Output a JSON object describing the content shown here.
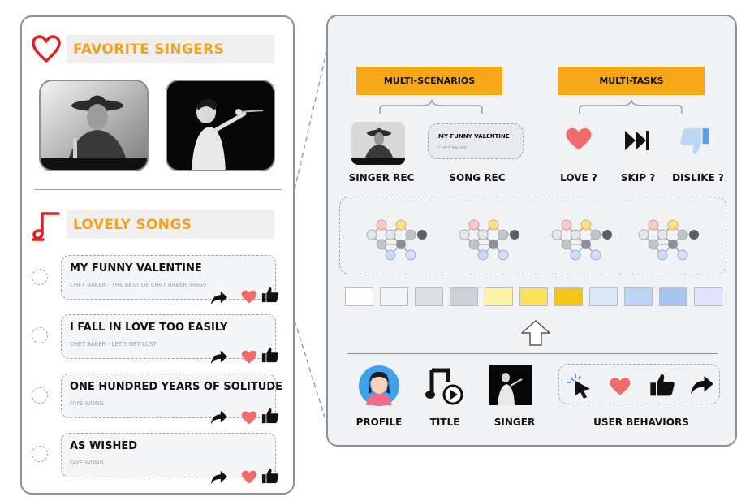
{
  "favorites": {
    "heading": "FAVORITE SINGERS"
  },
  "songs": {
    "heading": "LOVELY SONGS",
    "items": [
      {
        "title": "MY FUNNY VALENTINE",
        "subtitle": "CHET BAKER -  THE BEST OF CHET BAKER SINGS"
      },
      {
        "title": "I FALL IN LOVE TOO EASILY",
        "subtitle": "CHET BAKER -  LET'S GET LOST"
      },
      {
        "title": "ONE HUNDRED YEARS OF SOLITUDE",
        "subtitle": "FAYE WONG"
      },
      {
        "title": "AS WISHED",
        "subtitle": "FAYE WONG"
      }
    ]
  },
  "diagram": {
    "scenarios_label": "MULTI-SCENARIOS",
    "tasks_label": "MULTI-TASKS",
    "singer_rec": "SINGER REC",
    "song_rec": "SONG REC",
    "song_card_title": "MY FUNNY VALENTINE",
    "song_card_sub": "CHET BAKER",
    "love_q": "LOVE ?",
    "skip_q": "SKIP ?",
    "dislike_q": "DISLIKE ?",
    "profile": "PROFILE",
    "title": "TITLE",
    "singer": "SINGER",
    "user_behaviors": "USER BEHAVIORS"
  },
  "colors": {
    "accent_orange": "#f6a818",
    "heading_text": "#f4a21a",
    "heart": "#f26b6b",
    "red_icon": "#e02020",
    "dislike_blue": "#5b9ee8",
    "embedding": [
      "#ffffff",
      "#f3f4f6",
      "#dcdfe4",
      "#ccd0d7",
      "#fff3a8",
      "#fde15a",
      "#f6c51a",
      "#d9e8fb",
      "#bcd4f4",
      "#a6c4ee",
      "#dfe3fb"
    ]
  },
  "icons": [
    "heart-outline-icon",
    "music-note-icon",
    "share-arrow-icon",
    "heart-icon",
    "thumbs-up-icon",
    "skip-forward-icon",
    "thumbs-down-icon",
    "up-arrow-icon",
    "profile-avatar-icon",
    "music-title-icon",
    "cursor-click-icon"
  ]
}
